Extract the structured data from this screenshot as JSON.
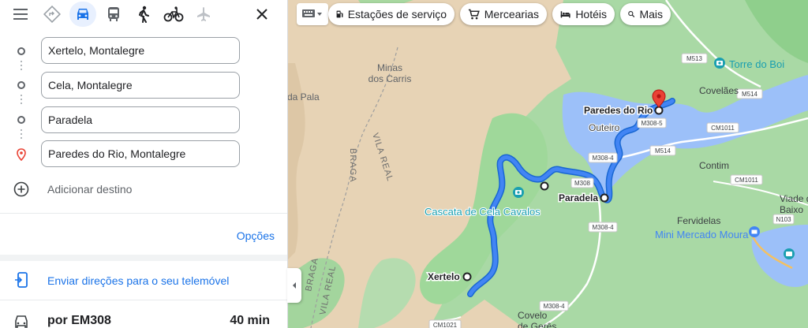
{
  "panel": {
    "modes": [
      {
        "name": "menu-icon"
      },
      {
        "name": "best-route-icon"
      },
      {
        "name": "car-icon",
        "active": true
      },
      {
        "name": "transit-icon"
      },
      {
        "name": "walk-icon"
      },
      {
        "name": "bicycle-icon"
      },
      {
        "name": "flight-icon"
      }
    ],
    "waypoints": [
      {
        "value": "Xertelo, Montalegre"
      },
      {
        "value": "Cela, Montalegre"
      },
      {
        "value": "Paradela"
      },
      {
        "value": "Paredes do Rio, Montalegre"
      }
    ],
    "add_destination": "Adicionar destino",
    "options": "Opções",
    "send_directions": "Enviar direções para o seu telemóvel",
    "route": {
      "via": "por EM308",
      "duration": "40 min"
    }
  },
  "map": {
    "chips": [
      {
        "label": "Estações de serviço",
        "icon": "gas-station-icon"
      },
      {
        "label": "Mercearias",
        "icon": "cart-icon"
      },
      {
        "label": "Hotéis",
        "icon": "bed-icon"
      },
      {
        "label": "Mais",
        "icon": "search-icon"
      }
    ],
    "labels": {
      "minas": "Minas",
      "dos_carris": "dos Carris",
      "da_pala": "da Pala",
      "braga1": "BRAGA",
      "vila_real1": "VILA REAL",
      "braga2": "BRAGA",
      "vila_real2": "VILA REAL",
      "paredes_do_rio": "Paredes do Rio",
      "outeiro": "Outeiro",
      "paradela": "Paradela",
      "xertelo": "Xertelo",
      "cascata": "Cascata de Cela Cavalos",
      "torre_do_boi": "Torre do Boi",
      "covelaes": "Covelães",
      "contim": "Contim",
      "viade1": "Viade de",
      "viade2": "Baixo",
      "fervidelas": "Fervidelas",
      "mini_mercado": "Mini Mercado Moura",
      "covelo1": "Covelo",
      "covelo2": "de Gerês"
    },
    "roads": {
      "m513": "M513",
      "m514a": "M514",
      "m514b": "M514",
      "cm1011a": "CM1011",
      "cm1011b": "CM1011",
      "m308_5": "M308-5",
      "m308_4a": "M308-4",
      "m308a": "M308",
      "m308_4b": "M308-4",
      "m308_4c": "M308-4",
      "n103": "N103",
      "cm1021": "CM1021"
    },
    "colors": {
      "route": "#4285f4",
      "route_border": "#1967d2",
      "water": "#9cc0f9",
      "forest": "#9fd89a",
      "terrain": "#e7d3b5",
      "marker": "#ea4335",
      "poi_teal": "#1a9fb0"
    }
  }
}
